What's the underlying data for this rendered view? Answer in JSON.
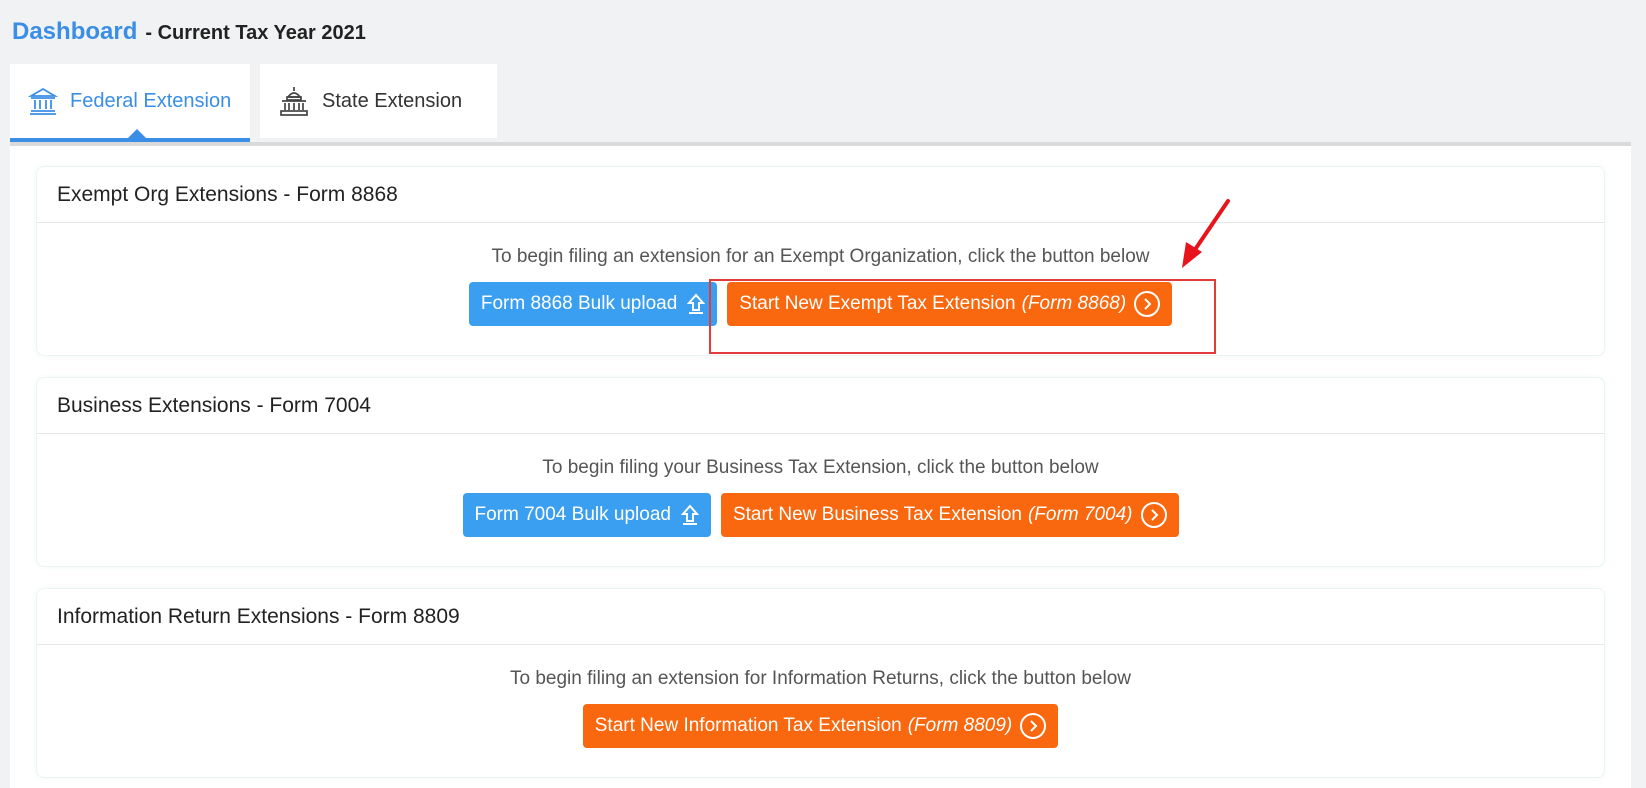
{
  "header": {
    "title": "Dashboard",
    "subtitle": "- Current Tax Year 2021"
  },
  "tabs": [
    {
      "label": "Federal Extension",
      "icon": "bank-icon",
      "active": true
    },
    {
      "label": "State Extension",
      "icon": "capitol-icon",
      "active": false
    }
  ],
  "cards": [
    {
      "title": "Exempt Org Extensions - Form 8868",
      "description": "To begin filing an extension for an Exempt Organization, click the button below",
      "bulk_label": "Form 8868 Bulk upload",
      "start_label": "Start New Exempt Tax Extension",
      "start_form": "(Form 8868)"
    },
    {
      "title": "Business Extensions - Form 7004",
      "description": "To begin filing your Business Tax Extension, click the button below",
      "bulk_label": "Form 7004 Bulk upload",
      "start_label": "Start New Business Tax Extension",
      "start_form": "(Form 7004)"
    },
    {
      "title": "Information Return Extensions - Form 8809",
      "description": "To begin filing an extension for Information Returns, click the button below",
      "start_label": "Start New Information Tax Extension",
      "start_form": "(Form 8809)"
    }
  ],
  "colors": {
    "accent_blue": "#3a8ee6",
    "button_blue": "#3a9ff0",
    "button_orange": "#f9670e",
    "annotation_red": "#e23b3b"
  }
}
